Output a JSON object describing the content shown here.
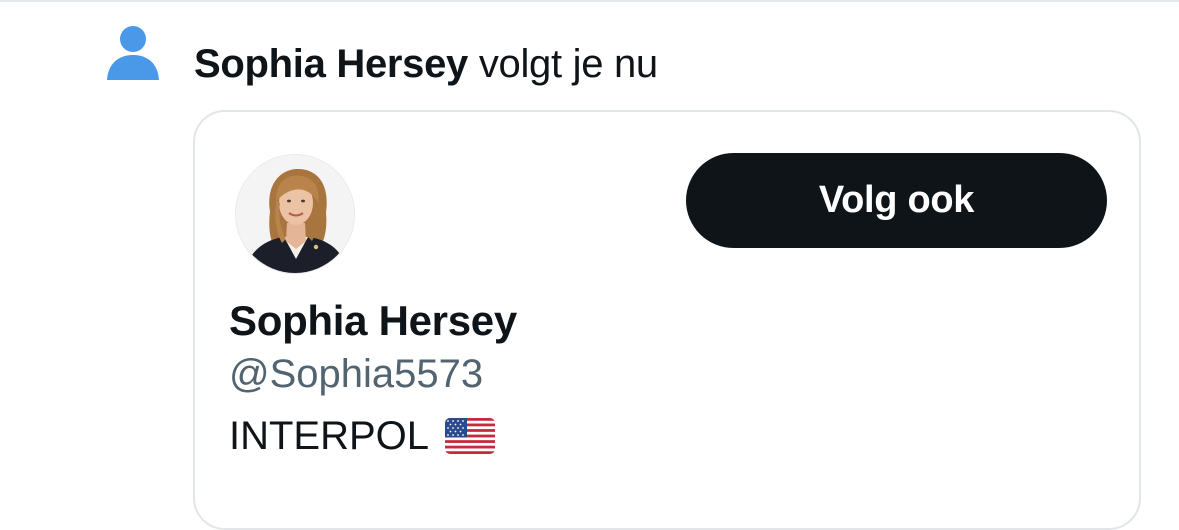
{
  "notification": {
    "icon": "person-icon",
    "icon_color": "#4a99e9",
    "name": "Sophia Hersey",
    "action": "volgt je nu"
  },
  "card": {
    "avatar": "profile-photo",
    "follow_button_label": "Volg ook",
    "display_name": "Sophia Hersey",
    "handle": "@Sophia5573",
    "bio_text": "INTERPOL",
    "bio_emoji": "us-flag-icon"
  },
  "colors": {
    "text_primary": "#0f1419",
    "text_secondary": "#536471",
    "button_bg": "#0f1419",
    "button_text": "#ffffff",
    "card_border": "#e3e6e9"
  }
}
